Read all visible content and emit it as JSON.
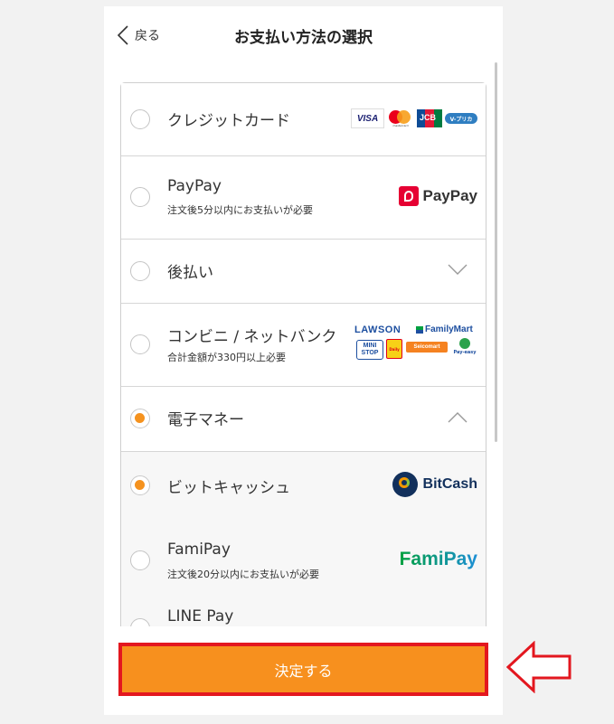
{
  "header": {
    "back_label": "戻る",
    "title": "お支払い方法の選択"
  },
  "methods": [
    {
      "label": "クレジットカード",
      "note": "",
      "selected": false,
      "logos": [
        "VISA",
        "mastercard",
        "JCB",
        "V-プリカ"
      ]
    },
    {
      "label": "PayPay",
      "note": "注文後5分以内にお支払いが必要",
      "selected": false,
      "logos": [
        "PayPay"
      ]
    },
    {
      "label": "後払い",
      "note": "",
      "selected": false,
      "expand": "closed"
    },
    {
      "label": "コンビニ / ネットバンク",
      "note": "合計金額が330円以上必要",
      "selected": false,
      "logos": [
        "LAWSON",
        "FamilyMart",
        "MINI STOP",
        "Daily",
        "Seicomart",
        "Pay-easy"
      ]
    },
    {
      "label": "電子マネー",
      "note": "",
      "selected": true,
      "expand": "open"
    }
  ],
  "submethods": [
    {
      "label": "ビットキャッシュ",
      "note": "",
      "selected": true,
      "logo": "BitCash"
    },
    {
      "label": "FamiPay",
      "note": "注文後20分以内にお支払いが必要",
      "selected": false,
      "logo": "FamiPay"
    },
    {
      "label": "LINE Pay",
      "note": "",
      "selected": false
    }
  ],
  "submit_label": "決定する",
  "colors": {
    "accent": "#f7901e",
    "highlight_border": "#e3171f",
    "radio_selected": "#f5921e"
  },
  "icons": [
    "chevron-left-icon",
    "chevron-down-icon",
    "chevron-up-icon",
    "left-arrow-outline-icon"
  ]
}
